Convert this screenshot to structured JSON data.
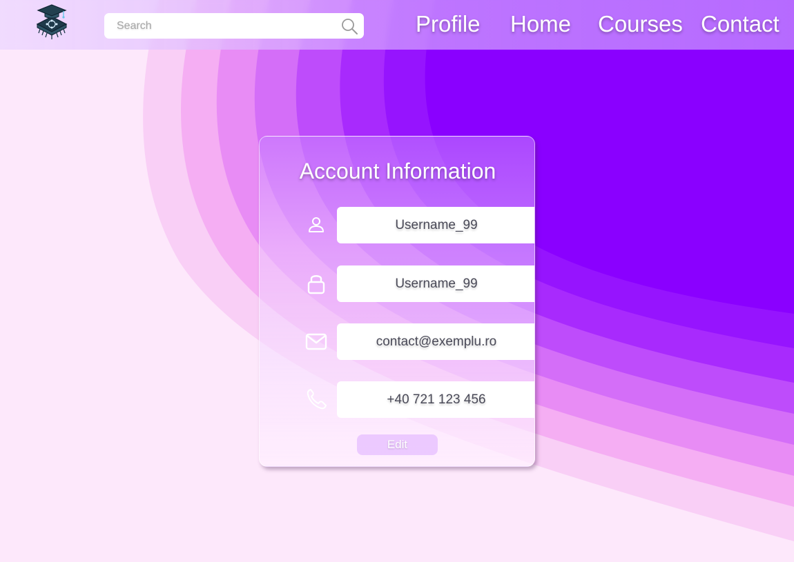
{
  "header": {
    "logo_icon": "graduation-cap-chip-icon",
    "search": {
      "placeholder": "Search",
      "value": "",
      "icon": "search-icon"
    },
    "nav": [
      {
        "label": "Profile"
      },
      {
        "label": "Home"
      },
      {
        "label": "Courses"
      },
      {
        "label": "Contact"
      }
    ]
  },
  "account": {
    "title": "Account Information",
    "fields": [
      {
        "icon": "user-icon",
        "value": "Username_99"
      },
      {
        "icon": "lock-icon",
        "value": "Username_99"
      },
      {
        "icon": "mail-icon",
        "value": "contact@exemplu.ro"
      },
      {
        "icon": "phone-icon",
        "value": "+40 721 123 456"
      }
    ],
    "edit_label": "Edit"
  },
  "colors": {
    "accent": "#8a00ff",
    "background": "#fde8fb",
    "text_dark": "#4a4a58",
    "white": "#ffffff"
  }
}
